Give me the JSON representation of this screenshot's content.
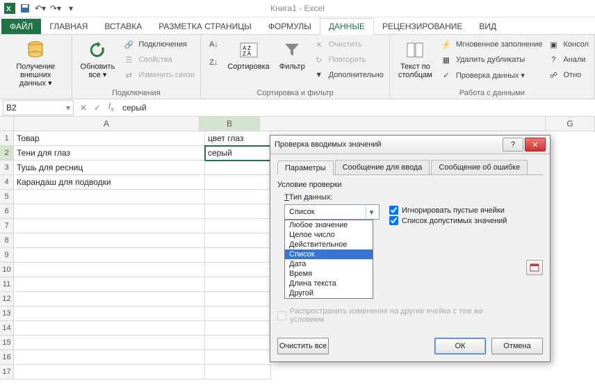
{
  "app_title": "Книга1 - Excel",
  "tabs": {
    "file": "ФАЙЛ",
    "home": "ГЛАВНАЯ",
    "insert": "ВСТАВКА",
    "layout": "РАЗМЕТКА СТРАНИЦЫ",
    "formulas": "ФОРМУЛЫ",
    "data": "ДАННЫЕ",
    "review": "РЕЦЕНЗИРОВАНИЕ",
    "view": "ВИД"
  },
  "ribbon": {
    "get_data": "Получение\nвнешних данных ▾",
    "refresh": "Обновить\nвсе ▾",
    "connections": "Подключения",
    "conns_items": {
      "a": "Подключения",
      "b": "Свойства",
      "c": "Изменить связи"
    },
    "sort_az": "А↓Я",
    "sort_za": "Я↓А",
    "sort": "Сортировка",
    "filter": "Фильтр",
    "filter_items": {
      "clear": "Очистить",
      "reapply": "Повторить",
      "adv": "Дополнительно"
    },
    "sort_filter": "Сортировка и фильтр",
    "text_cols": "Текст по\nстолбцам",
    "flash": "Мгновенное заполнение",
    "dedup": "Удалить дубликаты",
    "validate": "Проверка данных ▾",
    "consol": "Консол",
    "analysis": "Анали",
    "relat": "Отно",
    "work_data": "Работа с данными"
  },
  "namebox": "B2",
  "formula": "серый",
  "columns": [
    "A",
    "B",
    "G"
  ],
  "rows": [
    "1",
    "2",
    "3",
    "4",
    "5",
    "6",
    "7",
    "8",
    "9",
    "10",
    "11",
    "12",
    "13",
    "14",
    "15",
    "16",
    "17"
  ],
  "cells": {
    "A1": "Товар",
    "B1": "цвет глаз",
    "A2": "Тени для глаз",
    "B2": "серый",
    "A3": "Тушь для ресниц",
    "A4": "Карандаш для подводки"
  },
  "dialog": {
    "title": "Проверка вводимых значений",
    "tabs": {
      "params": "Параметры",
      "input": "Сообщение для ввода",
      "error": "Сообщение об ошибке"
    },
    "cond": "Условие проверки",
    "type_label": "Тип данных:",
    "type_value": "Список",
    "type_options": [
      "Любое значение",
      "Целое число",
      "Действительное",
      "Список",
      "Дата",
      "Время",
      "Длина текста",
      "Другой"
    ],
    "ignore_blank": "Игнорировать пустые ячейки",
    "in_cell_list": "Список допустимых значений",
    "propagate": "Распространить изменения на другие ячейки с тем же условием",
    "clear": "Очистить все",
    "ok": "ОК",
    "cancel": "Отмена"
  }
}
